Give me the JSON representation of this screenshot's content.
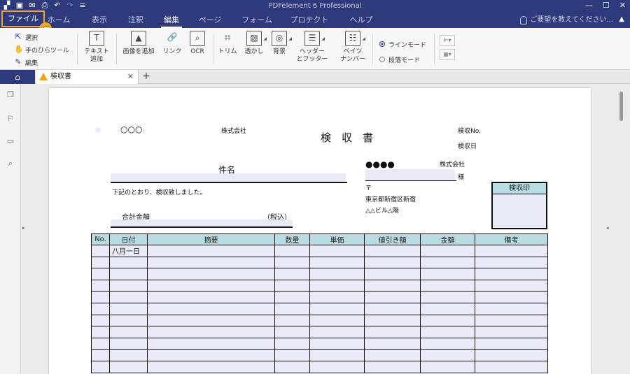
{
  "app": {
    "title": "PDFelement 6 Professional"
  },
  "quick_access": [
    "save-icon",
    "mail-icon",
    "print-icon",
    "undo-icon",
    "redo-icon",
    "customize-icon"
  ],
  "menu": {
    "file": "ファイル",
    "tabs": [
      "ホーム",
      "表示",
      "注釈",
      "編集",
      "ページ",
      "フォーム",
      "プロテクト",
      "ヘルプ"
    ],
    "active": "編集",
    "help_placeholder": "ご要望を教えてください..."
  },
  "ribbon": {
    "select": "選択",
    "hand": "手のひらツール",
    "edit": "編集",
    "text_add_1": "テキスト",
    "text_add_2": "追加",
    "image_add": "画像を追加",
    "link": "リンク",
    "ocr": "OCR",
    "crop": "トリム",
    "watermark": "透かし",
    "background": "背景",
    "header_footer_1": "ヘッダー",
    "header_footer_2": "とフッター",
    "bates_1": "ベイツ",
    "bates_2": "ナンバー",
    "line_mode": "ラインモード",
    "paragraph_mode": "段落モード"
  },
  "doc_tab": {
    "name": "検収書"
  },
  "document": {
    "circles": "○○○",
    "company_label": "株式会社",
    "title": "検　収　書",
    "receipt_no": "検収No.",
    "receipt_date": "検収日",
    "subject": "件名",
    "dots": "●●●●",
    "company_label_2": "株式会社",
    "honorific": "様",
    "statement": "下記のとおり、検収致しました。",
    "postal": "〒",
    "address_1": "東京都新宿区新宿",
    "address_2": "△△ビル△階",
    "total_label": "合計金額",
    "tax_incl": "（税込）",
    "stamp_label": "検収印",
    "table": {
      "headers": [
        "No.",
        "日付",
        "摘要",
        "数量",
        "単価",
        "値引き額",
        "金額",
        "備考"
      ],
      "first_row_date": "八月一日"
    }
  }
}
